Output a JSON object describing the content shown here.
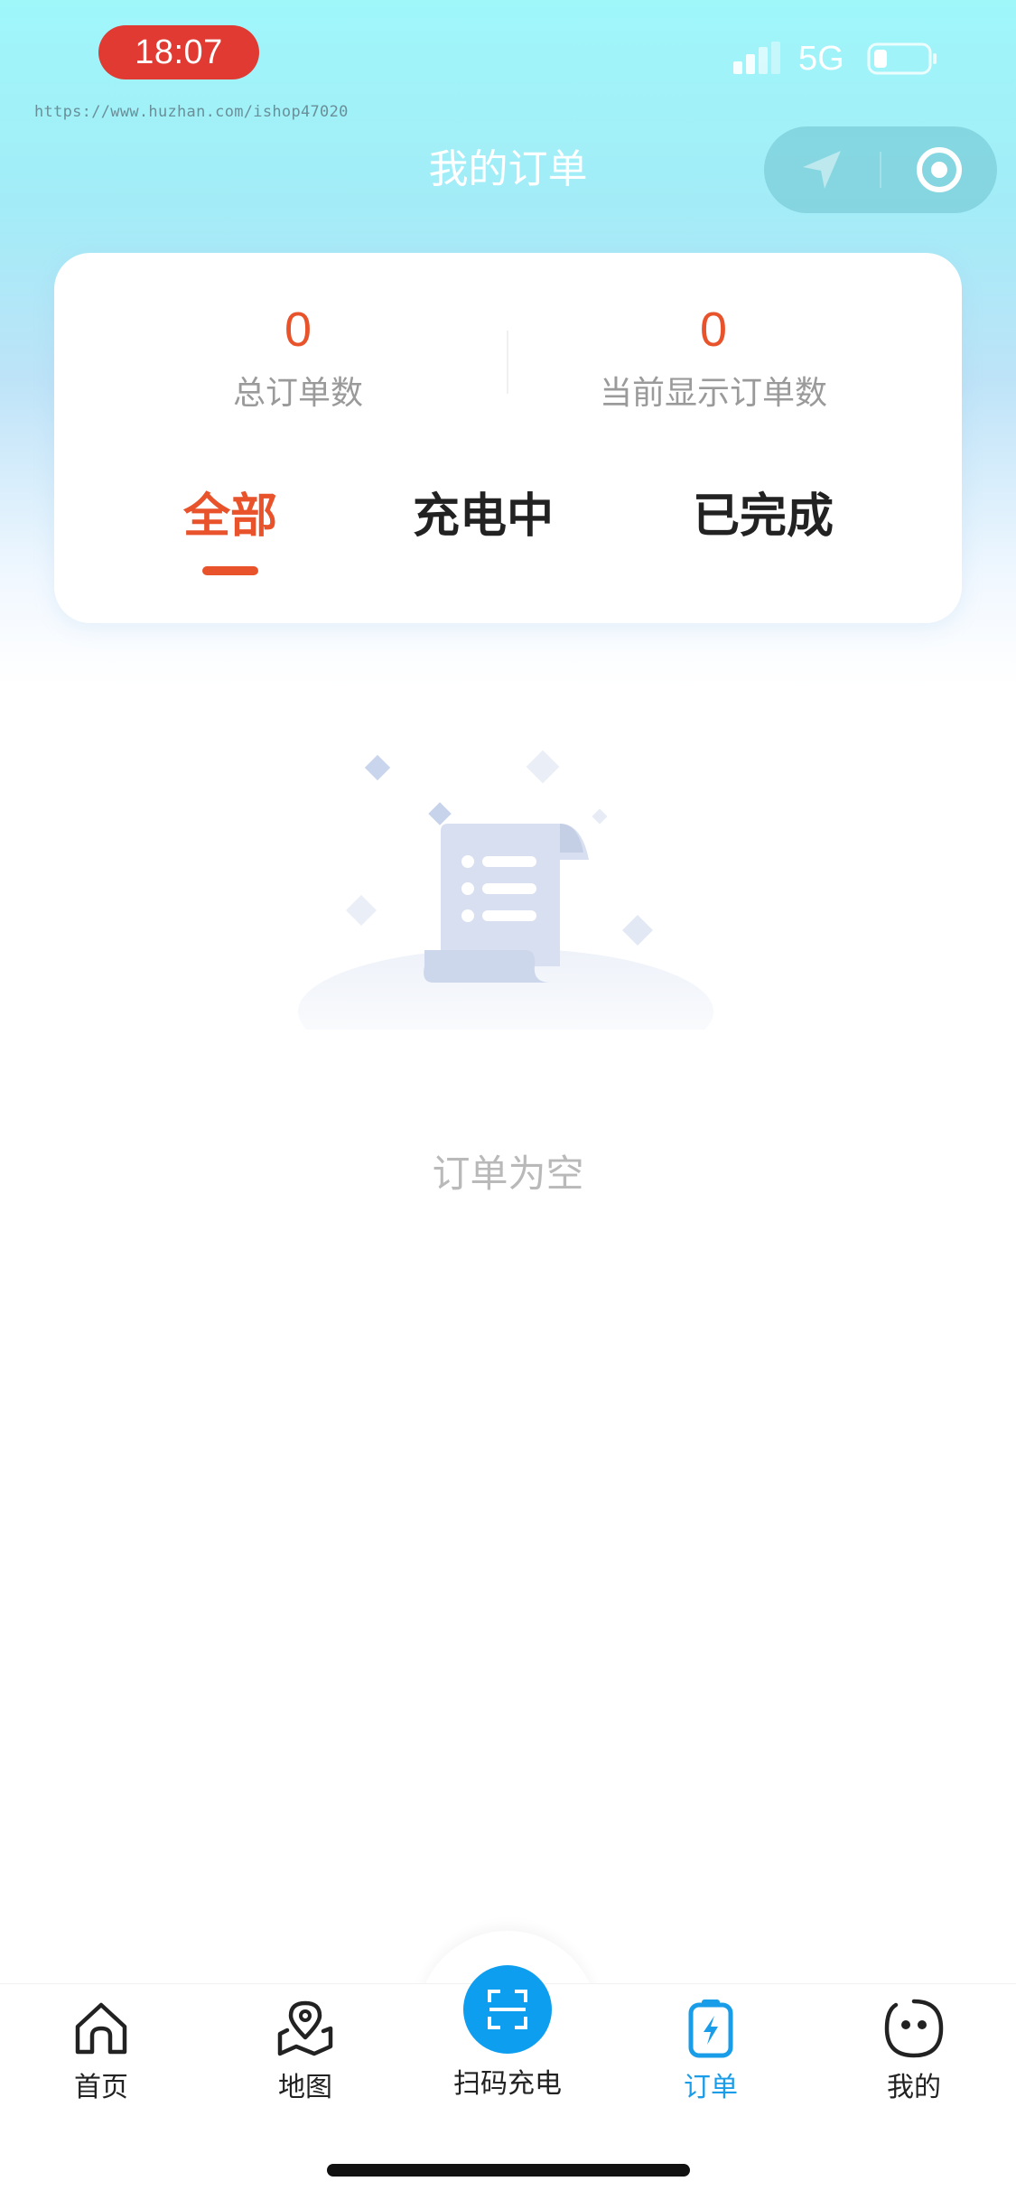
{
  "status_bar": {
    "time": "18:07",
    "network": "5G",
    "watermark": "https://www.huzhan.com/ishop47020"
  },
  "header": {
    "title": "我的订单",
    "capsule": {
      "left_icon": "location-arrow-icon",
      "right_icon": "target-circle-icon"
    }
  },
  "summary": {
    "total_orders": {
      "value": "0",
      "label": "总订单数"
    },
    "shown_orders": {
      "value": "0",
      "label": "当前显示订单数"
    }
  },
  "tabs": [
    {
      "label": "全部",
      "active": true
    },
    {
      "label": "充电中",
      "active": false
    },
    {
      "label": "已完成",
      "active": false
    }
  ],
  "empty_state": {
    "text": "订单为空",
    "icon": "empty-document-icon"
  },
  "tabbar": {
    "items": [
      {
        "label": "首页",
        "icon": "home-icon",
        "active": false
      },
      {
        "label": "地图",
        "icon": "map-pin-icon",
        "active": false
      },
      {
        "label": "扫码充电",
        "icon": "scan-icon",
        "active": false
      },
      {
        "label": "订单",
        "icon": "battery-charging-icon",
        "active": true
      },
      {
        "label": "我的",
        "icon": "smiley-face-icon",
        "active": false
      }
    ]
  },
  "colors": {
    "accent": "#e9532b",
    "tab_active": "#1a9de8",
    "scan_button": "#0e9ef0",
    "time_pill": "#e03a33"
  }
}
